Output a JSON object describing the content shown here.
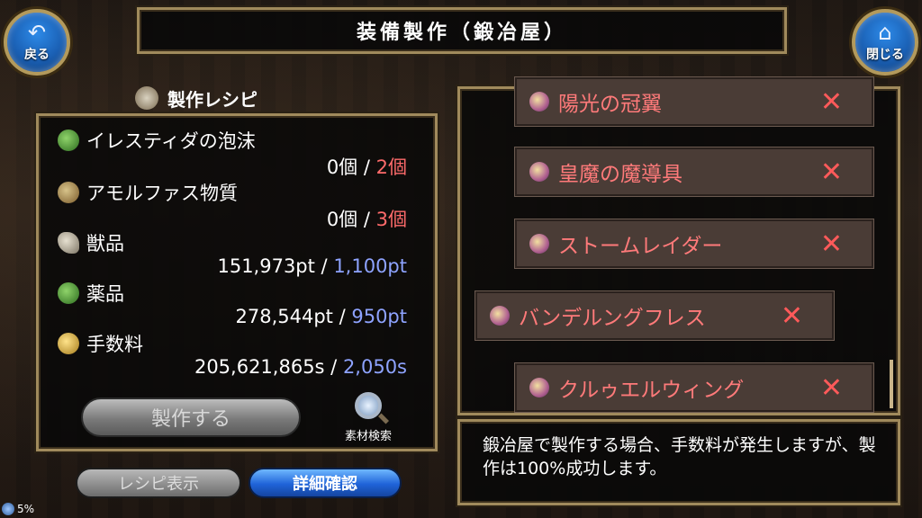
{
  "header": {
    "title": "装備製作（鍛冶屋）"
  },
  "nav": {
    "back_label": "戻る",
    "back_glyph": "↶",
    "close_label": "閉じる",
    "close_glyph": "⌂"
  },
  "recipe": {
    "heading": "製作レシピ",
    "materials": [
      {
        "name": "イレスティダの泡沫",
        "owned": "0個",
        "sep": " / ",
        "required": "2個",
        "required_color": "red"
      },
      {
        "name": "アモルファス物質",
        "owned": "0個",
        "sep": " / ",
        "required": "3個",
        "required_color": "red"
      },
      {
        "name": "獣品",
        "owned": "151,973pt",
        "sep": " / ",
        "required": "1,100pt",
        "required_color": "blue"
      },
      {
        "name": "薬品",
        "owned": "278,544pt",
        "sep": " / ",
        "required": "950pt",
        "required_color": "blue"
      },
      {
        "name": "手数料",
        "owned": "205,621,865s",
        "sep": " / ",
        "required": "2,050s",
        "required_color": "blue"
      }
    ],
    "make_label": "製作する",
    "search_label": "素材検索",
    "view_recipe_label": "レシピ表示",
    "detail_label": "詳細確認"
  },
  "items": [
    {
      "name": "陽光の冠翼",
      "mark": "✕"
    },
    {
      "name": "皇魔の魔導具",
      "mark": "✕"
    },
    {
      "name": "ストームレイダー",
      "mark": "✕"
    },
    {
      "name": "バンデルングフレス",
      "mark": "✕"
    },
    {
      "name": "クルゥエルウィング",
      "mark": "✕"
    }
  ],
  "message": "鍛冶屋で製作する場合、手数料が発生しますが、製作は100%成功します。",
  "status": {
    "battery": "5%"
  },
  "colors": {
    "required_red": "#ff6b6b",
    "required_blue": "#8ea3ff",
    "item_text": "#ff7a7a",
    "accent_blue": "#1f63d8"
  }
}
